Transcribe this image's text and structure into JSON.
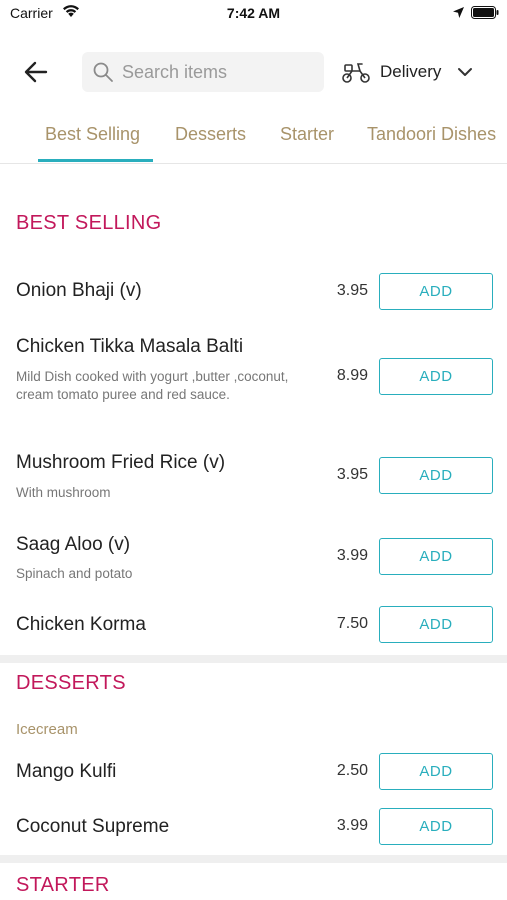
{
  "status_bar": {
    "carrier": "Carrier",
    "time": "7:42 AM"
  },
  "header": {
    "search_placeholder": "Search items",
    "search_value": "",
    "delivery_label": "Delivery"
  },
  "tabs": [
    {
      "label": "Best Selling",
      "active": true
    },
    {
      "label": "Desserts",
      "active": false
    },
    {
      "label": "Starter",
      "active": false
    },
    {
      "label": "Tandoori Dishes",
      "active": false
    }
  ],
  "sections": [
    {
      "title": "BEST SELLING",
      "items": [
        {
          "name": "Onion Bhaji (v)",
          "description": "",
          "price": "3.95",
          "add_label": "ADD"
        },
        {
          "name": "Chicken Tikka Masala Balti",
          "description": "Mild Dish cooked with yogurt ,butter ,coconut, cream tomato puree and red sauce.",
          "price": "8.99",
          "add_label": "ADD"
        },
        {
          "name": "Mushroom Fried Rice (v)",
          "description": "With mushroom",
          "price": "3.95",
          "add_label": "ADD"
        },
        {
          "name": "Saag Aloo (v)",
          "description": "Spinach and potato",
          "price": "3.99",
          "add_label": "ADD"
        },
        {
          "name": "Chicken Korma",
          "description": "",
          "price": "7.50",
          "add_label": "ADD"
        }
      ]
    },
    {
      "title": "DESSERTS",
      "subcategory": "Icecream",
      "items": [
        {
          "name": "Mango Kulfi",
          "description": "",
          "price": "2.50",
          "add_label": "ADD"
        },
        {
          "name": "Coconut Supreme",
          "description": "",
          "price": "3.99",
          "add_label": "ADD"
        }
      ]
    },
    {
      "title": "STARTER",
      "items": []
    }
  ],
  "colors": {
    "accent": "#29aebd",
    "section_title": "#c2185b",
    "tab_text": "#a8936a"
  },
  "icons": [
    "wifi-icon",
    "location-icon",
    "battery-icon",
    "back-arrow-icon",
    "search-icon",
    "scooter-icon",
    "chevron-down-icon"
  ]
}
